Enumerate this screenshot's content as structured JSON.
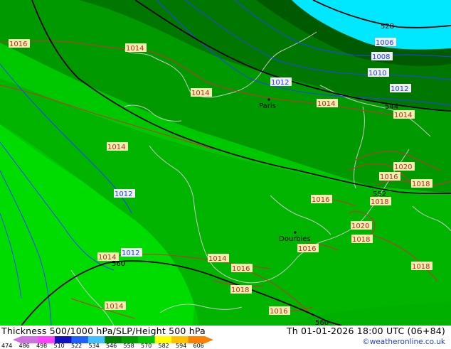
{
  "map": {
    "colors": {
      "band_dark": "#006400",
      "band_mid_dark": "#008a00",
      "band_mid": "#00a800",
      "band_light": "#00c000",
      "band_lighter": "#00d800",
      "band_cyan": "#00e8ff",
      "contour_thickness": "#000000",
      "contour_slp": "#cc2222",
      "contour_slp_blue": "#2040ff",
      "border": "#c8c8c8",
      "label_bg_yellow": "#f0f0b0"
    },
    "cities": [
      {
        "name": "Paris"
      },
      {
        "name": "Dourbies"
      }
    ],
    "slp_labels": [
      "1016",
      "1014",
      "1014",
      "1014",
      "1014",
      "1016",
      "1016",
      "1018",
      "1020",
      "1018",
      "1016",
      "1018",
      "1018",
      "1018",
      "1020",
      "1014",
      "1016",
      "1018",
      "1016",
      "1014",
      "1014",
      "1016",
      "1016",
      "1014",
      "1014"
    ],
    "blue_labels": [
      "1006",
      "1008",
      "1010",
      "1012",
      "1012",
      "1012",
      "1012"
    ],
    "thickness_labels": [
      "528",
      "544",
      "552",
      "560",
      "560"
    ]
  },
  "footer": {
    "title": "Thickness 500/1000 hPa/SLP/Height 500 hPa",
    "time": "Th 01-01-2026 18:00 UTC (06+84)",
    "credit": "©weatheronline.co.uk"
  },
  "colorbar": {
    "ticks": [
      "474",
      "486",
      "498",
      "510",
      "522",
      "534",
      "546",
      "558",
      "570",
      "582",
      "594",
      "606"
    ],
    "colors": [
      "#d070e0",
      "#ff40ff",
      "#1010c0",
      "#2060ff",
      "#40c0ff",
      "#008000",
      "#00a000",
      "#00c800",
      "#ffff00",
      "#ffc000",
      "#ff8000"
    ]
  }
}
